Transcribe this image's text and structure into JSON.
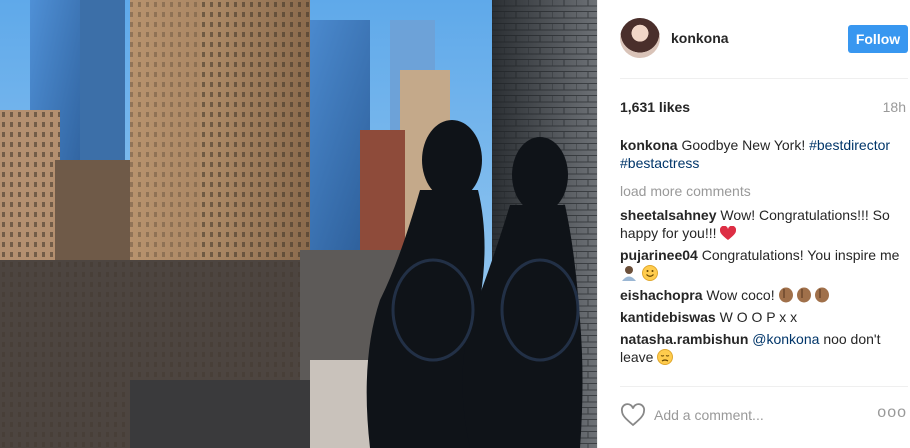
{
  "post": {
    "username": "konkona",
    "follow_label": "Follow",
    "likes": "1,631 likes",
    "time": "18h",
    "caption": {
      "user": "konkona",
      "text": "Goodbye New York!",
      "hashtag1": "#bestdirector",
      "hashtag2": "#bestactress"
    },
    "load_more": "load more comments",
    "comments": [
      {
        "user": "sheetalsahney",
        "text": "Wow! Congratulations!!! So happy for you!!!",
        "emoji": "heart"
      },
      {
        "user": "pujarinee04",
        "text": "Congratulations! You inspire me",
        "emoji": "person-smile"
      },
      {
        "user": "eishachopra",
        "text": "Wow coco!",
        "emoji": "clap-x3"
      },
      {
        "user": "kantidebiswas",
        "text": "W O O P x x",
        "emoji": ""
      },
      {
        "user": "natasha.rambishun",
        "mention": "@konkona",
        "text": "noo don't leave",
        "emoji": "sad-face"
      }
    ],
    "add_comment_placeholder": "Add a comment...",
    "more_label": "ooo"
  },
  "colors": {
    "follow": "#3897f0",
    "link": "#003569",
    "muted": "#999999"
  }
}
